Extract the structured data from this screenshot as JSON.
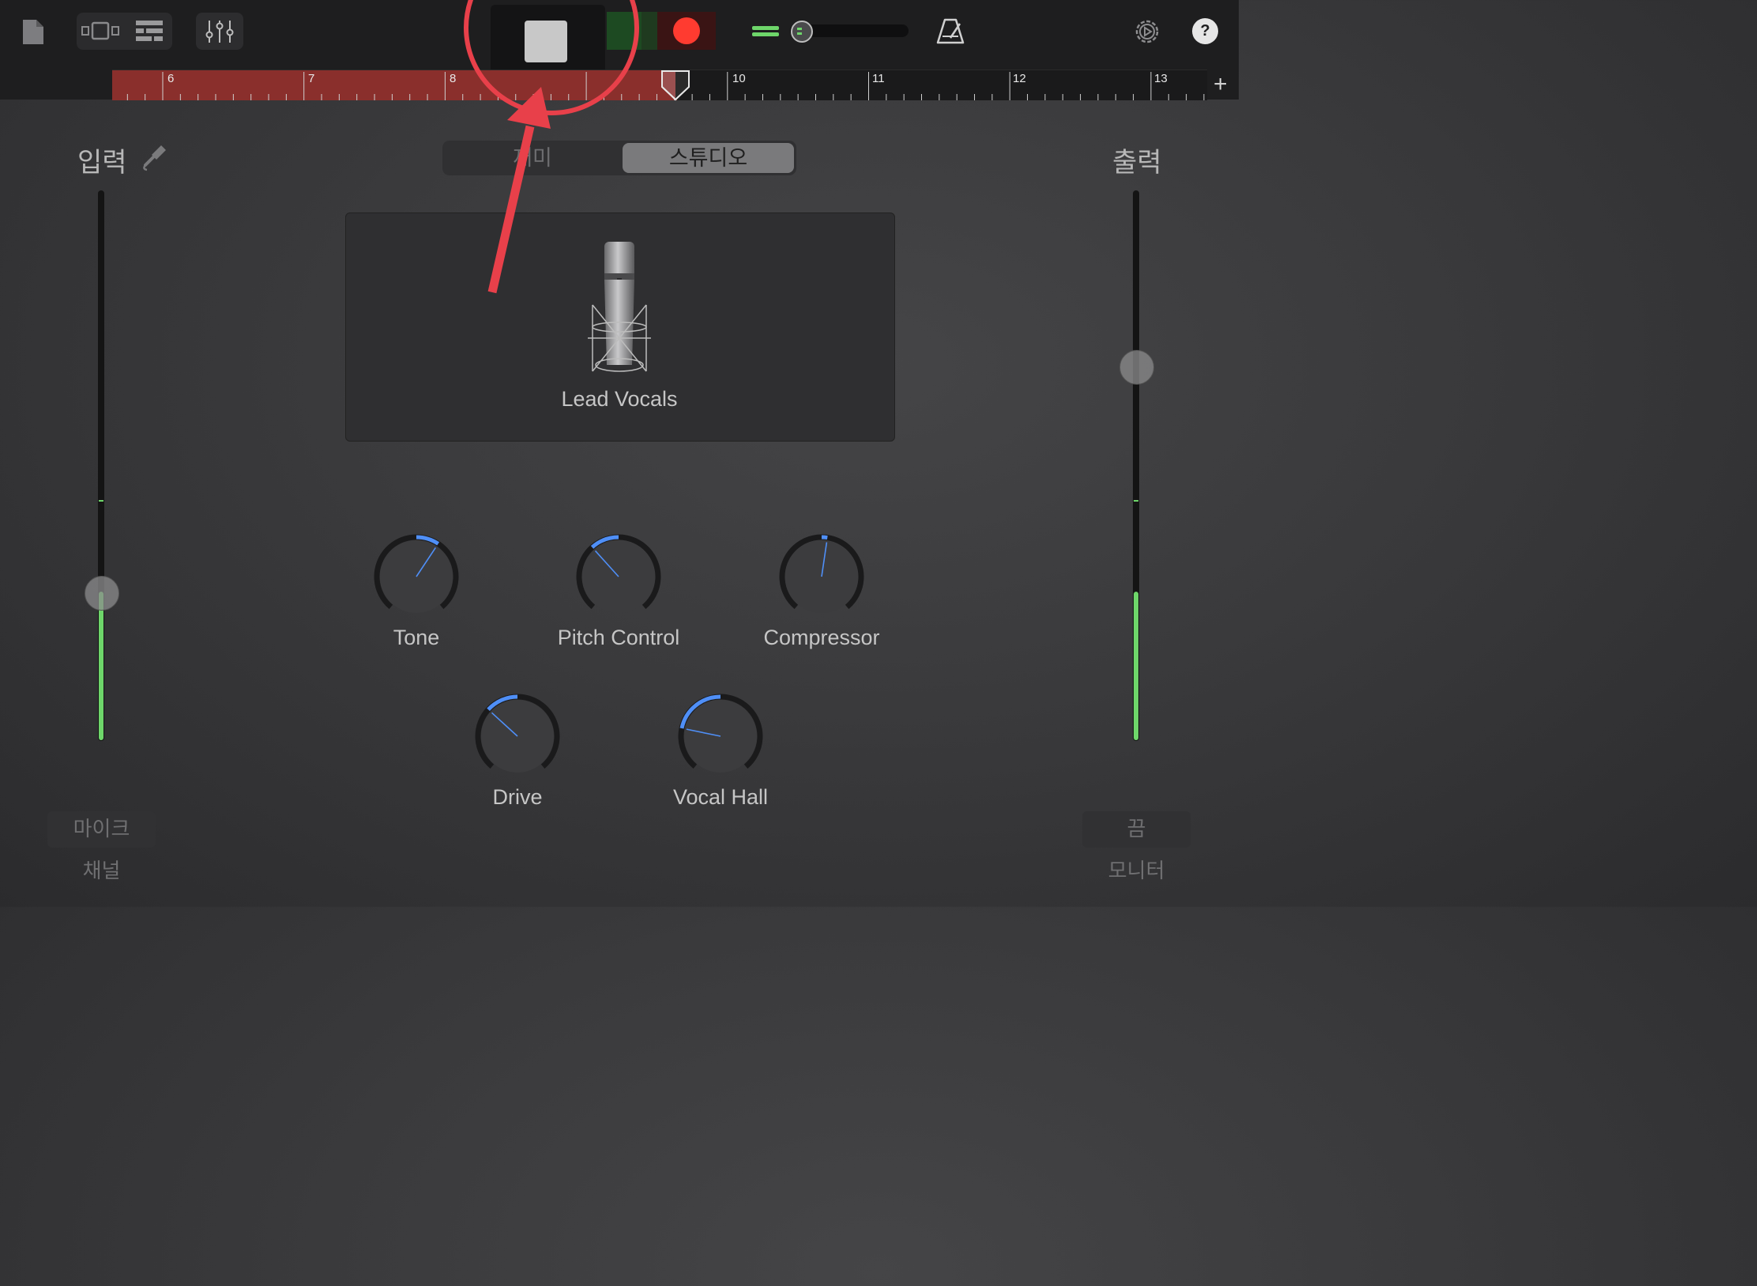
{
  "toolbar": {
    "icons": [
      "document-icon",
      "tracks-view-icon",
      "list-view-icon",
      "mixer-icon",
      "stop-icon",
      "record-icon",
      "volume-slider",
      "metronome-icon",
      "settings-icon",
      "help-icon"
    ],
    "help_label": "?",
    "master_volume": 0.0
  },
  "ruler": {
    "bars": [
      "6",
      "7",
      "8",
      "10",
      "11",
      "12",
      "13"
    ],
    "add_label": "+"
  },
  "mode_switch": {
    "options": [
      "재미",
      "스튜디오"
    ],
    "selected": "스튜디오"
  },
  "input": {
    "title": "입력",
    "level": 0.27,
    "meter": 0.27,
    "button": "마이크",
    "caption": "채널"
  },
  "output": {
    "title": "출력",
    "level": 0.68,
    "meter": 0.27,
    "button": "끔",
    "caption": "모니터"
  },
  "instrument": {
    "name": "Lead Vocals"
  },
  "knobs": [
    {
      "label": "Tone",
      "value": 0.62
    },
    {
      "label": "Pitch Control",
      "value": 0.35
    },
    {
      "label": "Compressor",
      "value": 0.53
    },
    {
      "label": "Drive",
      "value": 0.33
    },
    {
      "label": "Vocal Hall",
      "value": 0.22
    }
  ],
  "colors": {
    "accent_blue": "#4f8ff7",
    "record_red": "#ff3b30",
    "meter_green": "#6ed66a",
    "annotation_red": "#e8404a",
    "region_red": "#8a2f2c"
  }
}
